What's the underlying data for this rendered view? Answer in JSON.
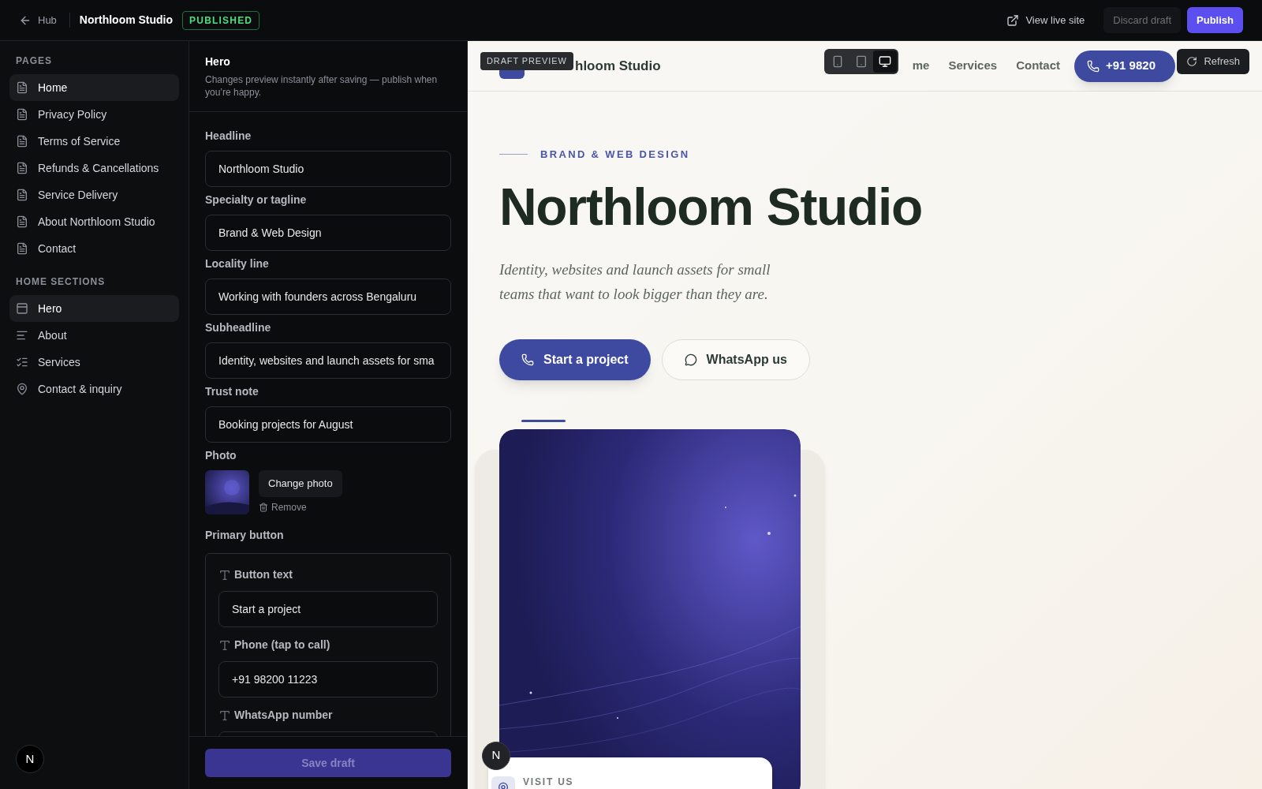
{
  "topbar": {
    "back": "Hub",
    "site_name": "Northloom Studio",
    "status": "PUBLISHED",
    "view_live": "View live site",
    "discard": "Discard draft",
    "publish": "Publish"
  },
  "sidebar": {
    "sections": [
      {
        "title": "PAGES",
        "items": [
          {
            "label": "Home",
            "kind": "page",
            "selected": true
          },
          {
            "label": "Privacy Policy",
            "kind": "page",
            "selected": false
          },
          {
            "label": "Terms of Service",
            "kind": "page",
            "selected": false
          },
          {
            "label": "Refunds & Cancellations",
            "kind": "page",
            "selected": false
          },
          {
            "label": "Service Delivery",
            "kind": "page",
            "selected": false
          },
          {
            "label": "About Northloom Studio",
            "kind": "page",
            "selected": false
          },
          {
            "label": "Contact",
            "kind": "page",
            "selected": false
          }
        ]
      },
      {
        "title": "HOME SECTIONS",
        "items": [
          {
            "label": "Hero",
            "kind": "hero",
            "selected": true
          },
          {
            "label": "About",
            "kind": "about",
            "selected": false
          },
          {
            "label": "Services",
            "kind": "services",
            "selected": false
          },
          {
            "label": "Contact & inquiry",
            "kind": "contact",
            "selected": false
          }
        ]
      }
    ],
    "avatar": "N"
  },
  "editor": {
    "title": "Hero",
    "hint": "Changes preview instantly after saving — publish when you’re happy.",
    "fields": [
      {
        "label": "Headline",
        "value": "Northloom Studio"
      },
      {
        "label": "Specialty or tagline",
        "value": "Brand & Web Design"
      },
      {
        "label": "Locality line",
        "value": "Working with founders across Bengaluru"
      },
      {
        "label": "Subheadline",
        "value": "Identity, websites and launch assets for sma"
      },
      {
        "label": "Trust note",
        "value": "Booking projects for August"
      }
    ],
    "photo": {
      "label": "Photo",
      "change": "Change photo",
      "remove": "Remove"
    },
    "primary_button": {
      "label": "Primary button",
      "fields": [
        {
          "label": "Button text",
          "value": "Start a project"
        },
        {
          "label": "Phone (tap to call)",
          "value": "+91 98200 11223"
        },
        {
          "label": "WhatsApp number"
        }
      ]
    },
    "save": {
      "label": "Save draft",
      "disabled": true
    }
  },
  "preview": {
    "badge": "DRAFT PREVIEW",
    "devices": [
      {
        "kind": "phone",
        "selected": false
      },
      {
        "kind": "tablet",
        "selected": false
      },
      {
        "kind": "desktop",
        "selected": true
      }
    ],
    "refresh": "Refresh",
    "nav": {
      "brand": "hloom Studio",
      "links": [
        "me",
        "Services",
        "Contact"
      ],
      "phone": "+91 9820"
    },
    "hero": {
      "eyebrow": "BRAND & WEB DESIGN",
      "headline": "Northloom Studio",
      "subheadline": "Identity, websites and launch assets for small teams that want to look bigger than they are.",
      "primary_cta": "Start a project",
      "secondary_cta": "WhatsApp us",
      "visit_label": "VISIT US"
    },
    "avatar": "N"
  }
}
